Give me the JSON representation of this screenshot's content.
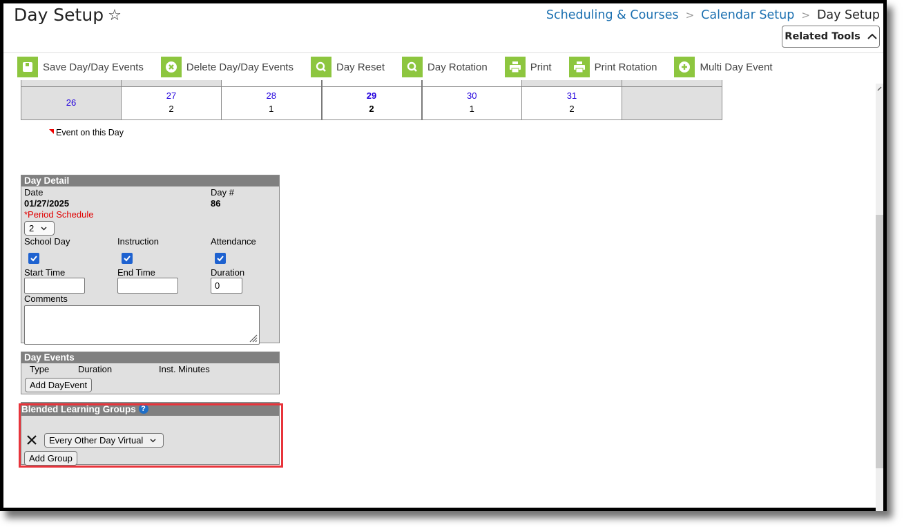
{
  "header": {
    "title": "Day Setup",
    "breadcrumb": [
      "Scheduling & Courses",
      "Calendar Setup",
      "Day Setup"
    ],
    "related_tools_label": "Related Tools"
  },
  "toolbar": {
    "items": [
      {
        "label": "Save Day/Day Events",
        "icon": "save-icon"
      },
      {
        "label": "Delete Day/Day Events",
        "icon": "delete-icon"
      },
      {
        "label": "Day Reset",
        "icon": "search-icon"
      },
      {
        "label": "Day Rotation",
        "icon": "search-icon"
      },
      {
        "label": "Print",
        "icon": "print-icon"
      },
      {
        "label": "Print Rotation",
        "icon": "print-icon"
      },
      {
        "label": "Multi Day Event",
        "icon": "add-icon"
      }
    ]
  },
  "calendar": {
    "week": [
      {
        "day": "26",
        "rotation": ""
      },
      {
        "day": "27",
        "rotation": "2"
      },
      {
        "day": "28",
        "rotation": "1"
      },
      {
        "day": "29",
        "rotation": "2"
      },
      {
        "day": "30",
        "rotation": "1"
      },
      {
        "day": "31",
        "rotation": "2"
      },
      {
        "day": "",
        "rotation": ""
      }
    ],
    "legend": "Event on this Day"
  },
  "day_detail": {
    "title": "Day Detail",
    "date_label": "Date",
    "date_value": "01/27/2025",
    "daynum_label": "Day #",
    "daynum_value": "86",
    "period_schedule_label": "*Period Schedule",
    "period_schedule_value": "2",
    "school_day_label": "School Day",
    "school_day_checked": true,
    "instruction_label": "Instruction",
    "instruction_checked": true,
    "attendance_label": "Attendance",
    "attendance_checked": true,
    "start_time_label": "Start Time",
    "start_time_value": "",
    "end_time_label": "End Time",
    "end_time_value": "",
    "duration_label": "Duration",
    "duration_value": "0",
    "comments_label": "Comments",
    "comments_value": ""
  },
  "day_events": {
    "title": "Day Events",
    "columns": [
      "Type",
      "Duration",
      "Inst. Minutes"
    ],
    "add_button": "Add DayEvent"
  },
  "blended": {
    "title": "Blended Learning Groups",
    "group_value": "Every Other Day Virtual",
    "add_button": "Add Group"
  },
  "colors": {
    "accent_green": "#8dc63f",
    "link_blue": "#1a6fb0",
    "highlight_red": "#e8343b",
    "required_red": "#e00000"
  }
}
